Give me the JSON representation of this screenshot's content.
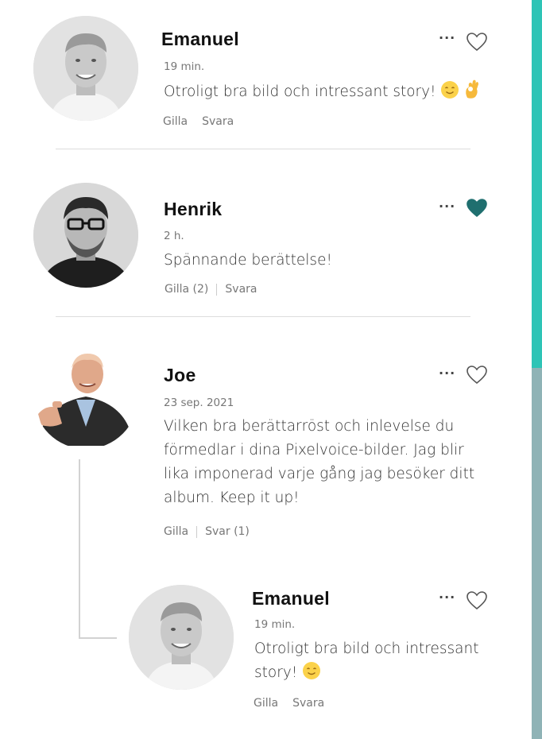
{
  "comments": [
    {
      "name": "Emanuel",
      "time": "19 min.",
      "text": "Otroligt bra bild och intressant story!",
      "emoji_icons": [
        "smiling-face-icon",
        "ok-hand-icon"
      ],
      "like_label": "Gilla",
      "reply_label": "Svara",
      "liked": false
    },
    {
      "name": "Henrik",
      "time": "2 h.",
      "text": "Spännande berättelse!",
      "like_label": "Gilla (2)",
      "reply_label": "Svara",
      "liked": true
    },
    {
      "name": "Joe",
      "time": "23 sep. 2021",
      "text": "Vilken bra berättarröst och inlevelse du förmedlar i dina Pixelvoice-bilder. Jag blir lika imponerad varje gång jag besöker ditt album. Keep it up!",
      "like_label": "Gilla",
      "reply_label": "Svar (1)",
      "liked": false,
      "replies": [
        {
          "name": "Emanuel",
          "time": "19 min.",
          "text_line1": "Otroligt bra bild och intressant",
          "text_line2": "story!",
          "emoji_icons": [
            "smiling-face-icon"
          ],
          "like_label": "Gilla",
          "reply_label": "Svara",
          "liked": false
        }
      ]
    }
  ],
  "more_icon": "more-dots-icon",
  "colors": {
    "accent": "#2ec4b6",
    "liked_heart": "#1f6f6f",
    "scroll_track": "#8fb3b6"
  }
}
